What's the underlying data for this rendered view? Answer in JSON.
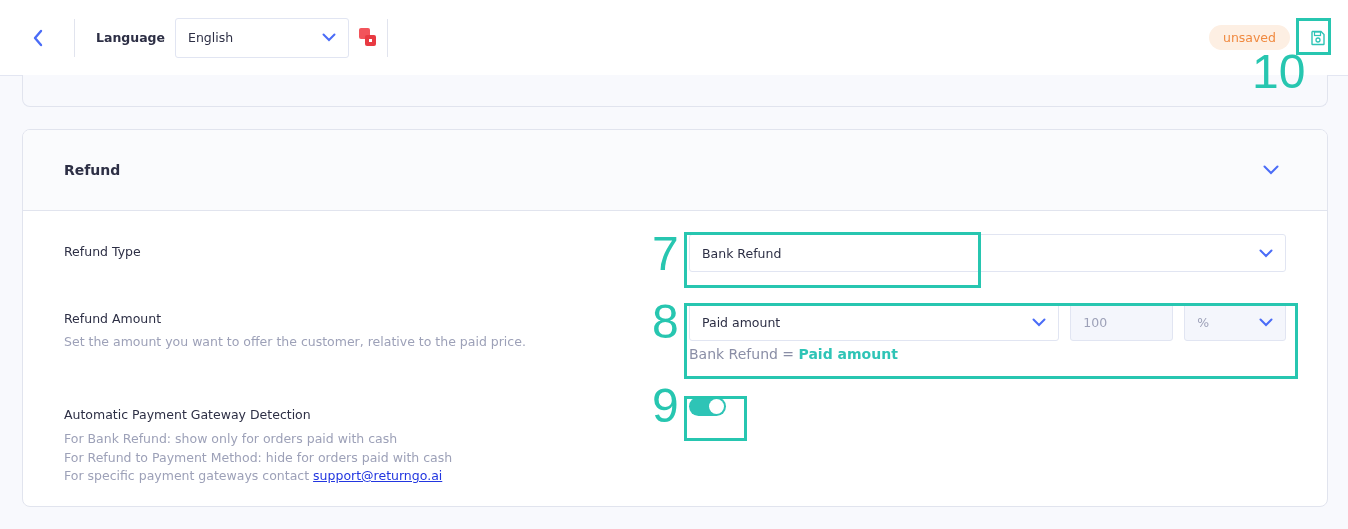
{
  "topbar": {
    "language_label": "Language",
    "language": "English",
    "status_badge": "unsaved"
  },
  "section": {
    "title": "Refund",
    "expanded": true,
    "refund_type": {
      "label": "Refund Type",
      "value": "Bank Refund"
    },
    "refund_amount": {
      "label": "Refund Amount",
      "description": "Set the amount you want to offer the customer, relative to the paid price.",
      "basis": "Paid amount",
      "amount": "100",
      "unit": "%",
      "formula_prefix": "Bank Refund =",
      "formula_value": "Paid amount"
    },
    "gateway_detection": {
      "label": "Automatic Payment Gateway Detection",
      "on": true,
      "help": [
        "For Bank Refund: show only for orders paid with cash",
        "For Refund to Payment Method: hide for orders paid with cash"
      ],
      "contact_text": "For specific payment gateways contact",
      "contact_link": "support@returngo.ai"
    }
  },
  "annotations": [
    {
      "label": "7"
    },
    {
      "label": "8"
    },
    {
      "label": "9"
    },
    {
      "label": "10"
    }
  ]
}
